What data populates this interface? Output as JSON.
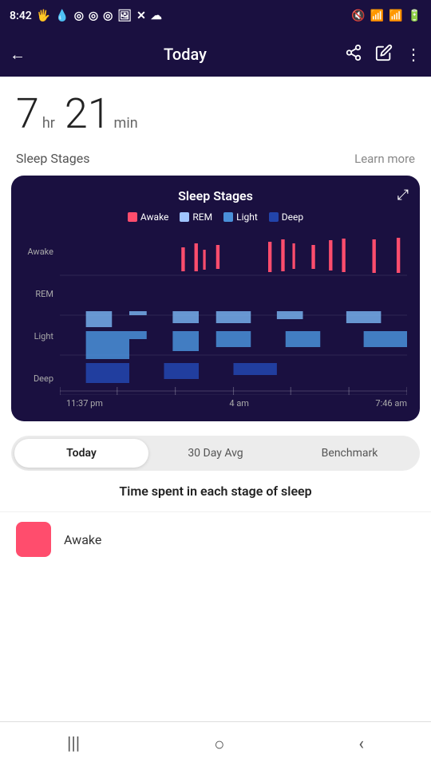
{
  "statusBar": {
    "time": "8:42",
    "icons": [
      "hand",
      "water",
      "ring1",
      "ring2",
      "ring3",
      "image",
      "x",
      "cloud"
    ]
  },
  "nav": {
    "title": "Today",
    "backLabel": "←",
    "shareIcon": "share",
    "editIcon": "edit",
    "moreIcon": "more"
  },
  "sleepDuration": {
    "hours": "7",
    "hoursUnit": "hr",
    "minutes": "21",
    "minutesUnit": "min"
  },
  "sleepStagesSection": {
    "title": "Sleep Stages",
    "learnMore": "Learn more"
  },
  "chart": {
    "title": "Sleep Stages",
    "expandIcon": "⤢",
    "legend": [
      {
        "key": "awake",
        "label": "Awake",
        "color": "#ff4d6d"
      },
      {
        "key": "rem",
        "label": "REM",
        "color": "#a0c4ff"
      },
      {
        "key": "light",
        "label": "Light",
        "color": "#4a90d9"
      },
      {
        "key": "deep",
        "label": "Deep",
        "color": "#2244aa"
      }
    ],
    "yLabels": [
      "Awake",
      "REM",
      "Light",
      "Deep"
    ],
    "xLabels": [
      "11:37 pm",
      "4 am",
      "7:46 am"
    ]
  },
  "tabs": [
    {
      "key": "today",
      "label": "Today",
      "active": true
    },
    {
      "key": "30day",
      "label": "30 Day Avg",
      "active": false
    },
    {
      "key": "benchmark",
      "label": "Benchmark",
      "active": false
    }
  ],
  "timeSpentSection": {
    "title": "Time spent in each stage of sleep"
  },
  "stageRows": [
    {
      "key": "awake",
      "label": "Awake",
      "color": "#ff4d6d"
    }
  ],
  "bottomNav": {
    "icons": [
      "|||",
      "○",
      "<"
    ]
  }
}
